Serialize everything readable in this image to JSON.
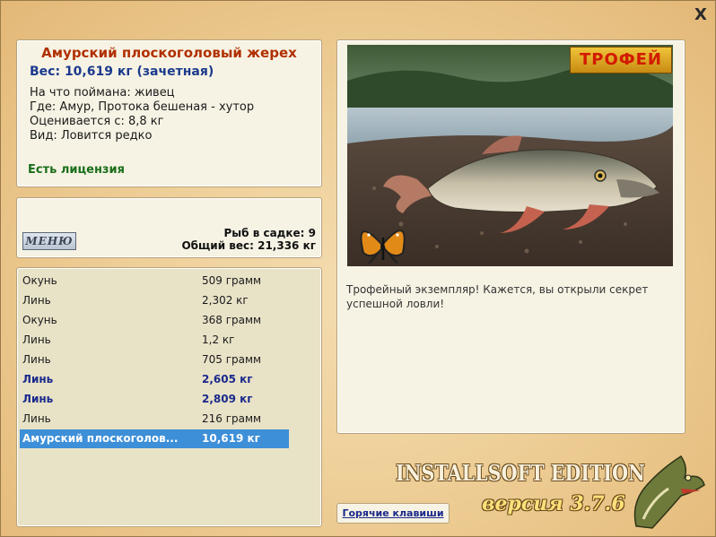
{
  "window": {
    "close_label": "X"
  },
  "fish": {
    "title": "Амурский плоскоголовый жерех",
    "weight": "Вес: 10,619 кг (зачетная)",
    "bait": "На что поймана: живец",
    "where": "Где: Амур, Протока бешеная - хутор",
    "value_from": "Оценивается с: 8,8 кг",
    "kind": "Вид: Ловится редко",
    "license": "Есть лицензия"
  },
  "summary": {
    "menu_label": "МЕНЮ",
    "fish_count": "Рыб в садке: 9",
    "total_weight": "Общий вес: 21,336 кг"
  },
  "catch_list": [
    {
      "name": "Окунь",
      "weight": "509 грамм",
      "style": "normal"
    },
    {
      "name": "Линь",
      "weight": "2,302 кг",
      "style": "normal"
    },
    {
      "name": "Окунь",
      "weight": "368 грамм",
      "style": "normal"
    },
    {
      "name": "Линь",
      "weight": "1,2 кг",
      "style": "normal"
    },
    {
      "name": "Линь",
      "weight": "705 грамм",
      "style": "normal"
    },
    {
      "name": "Линь",
      "weight": "2,605 кг",
      "style": "bold"
    },
    {
      "name": "Линь",
      "weight": "2,809 кг",
      "style": "bold"
    },
    {
      "name": "Линь",
      "weight": "216 грамм",
      "style": "normal"
    },
    {
      "name": "Амурский плоскоголов...",
      "weight": "10,619 кг",
      "style": "selected"
    }
  ],
  "photo": {
    "trophy_badge": "ТРОФЕЙ",
    "caption": "Трофейный экземпляр! Кажется, вы открыли секрет успешной ловли!"
  },
  "footer": {
    "hotkeys_label": "Горячие клавиши",
    "edition": "INSTALLSOFT EDITION",
    "version": "версия 3.7.6"
  }
}
